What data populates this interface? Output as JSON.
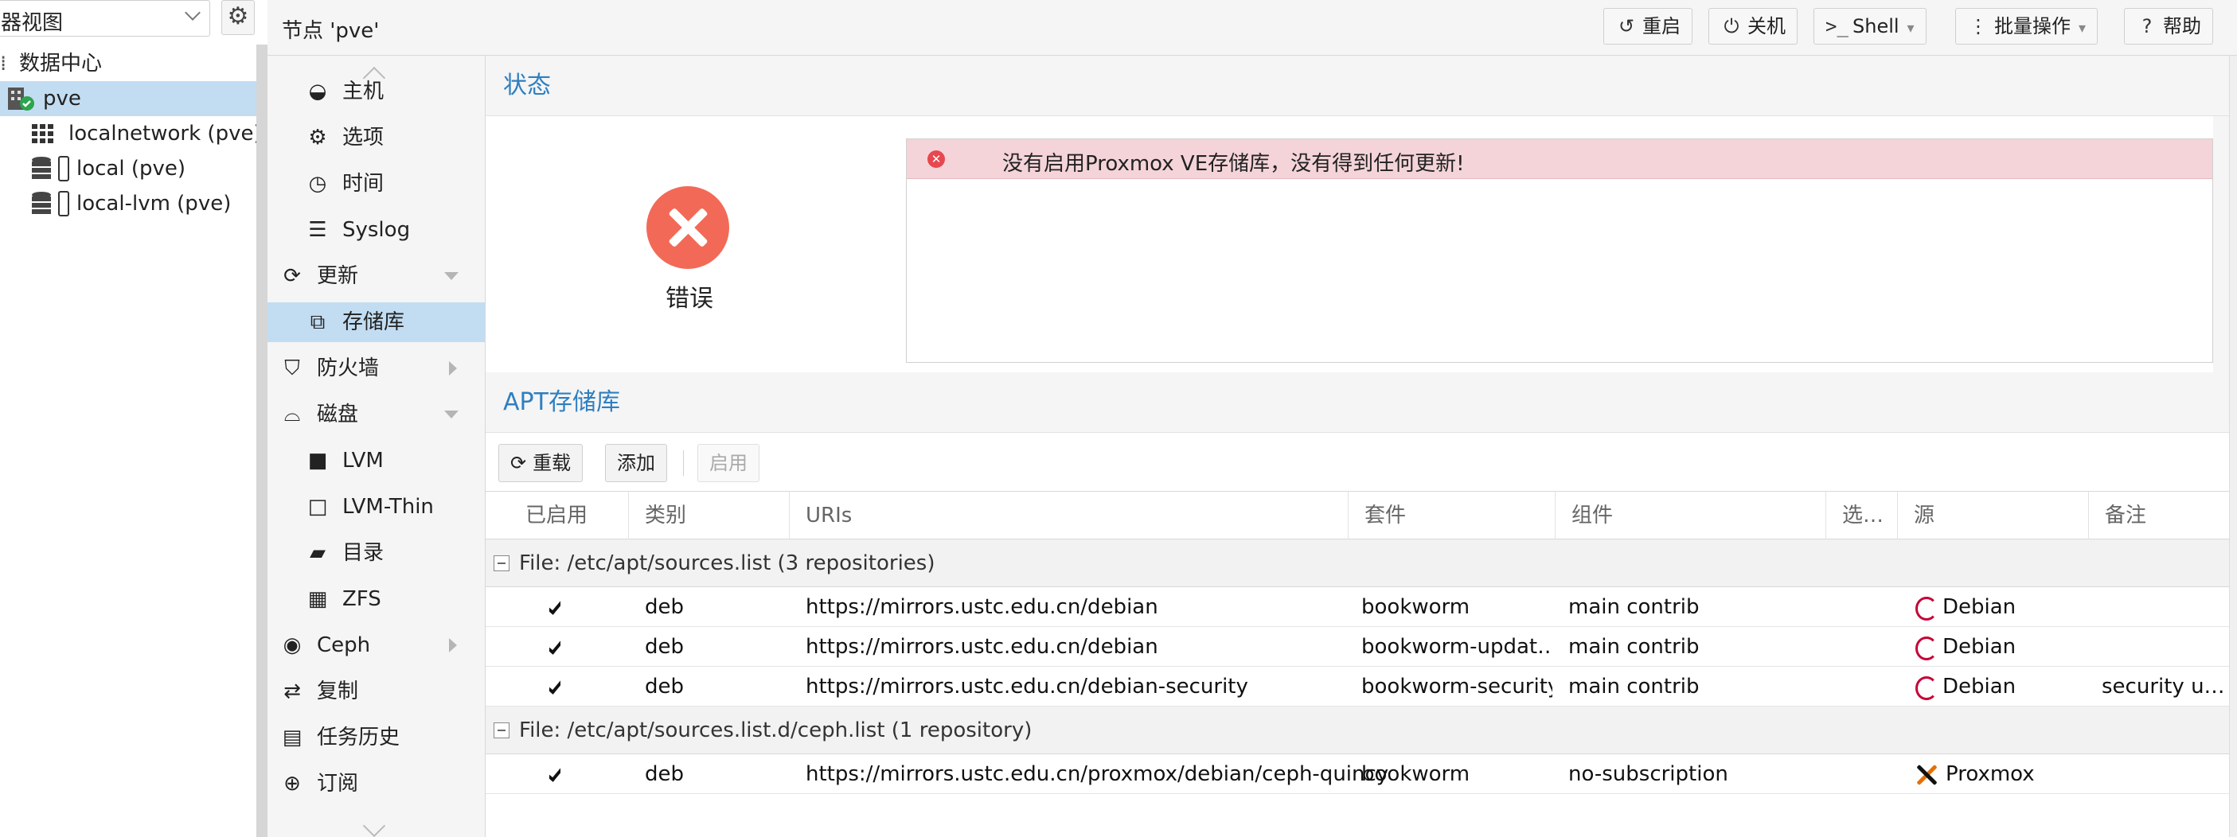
{
  "tree": {
    "view_select": "器视图",
    "items": [
      {
        "label": "数据中心"
      },
      {
        "label": "pve"
      },
      {
        "label": "localnetwork (pve)"
      },
      {
        "label": "local (pve)"
      },
      {
        "label": "local-lvm (pve)"
      }
    ]
  },
  "header": {
    "title": "节点 'pve'",
    "buttons": {
      "reboot": "重启",
      "shutdown": "关机",
      "shell": "Shell",
      "bulk": "批量操作",
      "help": "帮助"
    }
  },
  "menu": {
    "items": [
      {
        "label": "主机",
        "icon": "host-icon"
      },
      {
        "label": "选项",
        "icon": "gear-icon"
      },
      {
        "label": "时间",
        "icon": "clock-icon"
      },
      {
        "label": "Syslog",
        "icon": "list-icon"
      },
      {
        "label": "更新",
        "icon": "refresh-icon"
      },
      {
        "label": "存储库",
        "icon": "copy-icon"
      },
      {
        "label": "防火墙",
        "icon": "shield-icon"
      },
      {
        "label": "磁盘",
        "icon": "hdd-icon"
      },
      {
        "label": "LVM",
        "icon": "square-icon"
      },
      {
        "label": "LVM-Thin",
        "icon": "square-outline-icon"
      },
      {
        "label": "目录",
        "icon": "folder-icon"
      },
      {
        "label": "ZFS",
        "icon": "grid-icon"
      },
      {
        "label": "Ceph",
        "icon": "ceph-icon"
      },
      {
        "label": "复制",
        "icon": "retweet-icon"
      },
      {
        "label": "任务历史",
        "icon": "tasks-icon"
      },
      {
        "label": "订阅",
        "icon": "lifebuoy-icon"
      }
    ]
  },
  "status": {
    "title": "状态",
    "state_label": "错误",
    "message": "没有启用Proxmox VE存储库，没有得到任何更新!"
  },
  "apt": {
    "title": "APT存储库",
    "buttons": {
      "reload": "重载",
      "add": "添加",
      "enable": "启用"
    },
    "columns": [
      "已启用",
      "类别",
      "URIs",
      "套件",
      "组件",
      "选…",
      "源",
      "备注"
    ],
    "groups": [
      {
        "label": "File: /etc/apt/sources.list (3 repositories)",
        "rows": [
          {
            "enabled": "✔",
            "type": "deb",
            "uri": "https://mirrors.ustc.edu.cn/debian",
            "suite": "bookworm",
            "components": "main contrib",
            "options": "",
            "origin": "Debian",
            "comment": ""
          },
          {
            "enabled": "✔",
            "type": "deb",
            "uri": "https://mirrors.ustc.edu.cn/debian",
            "suite": "bookworm-updat…",
            "components": "main contrib",
            "options": "",
            "origin": "Debian",
            "comment": ""
          },
          {
            "enabled": "✔",
            "type": "deb",
            "uri": "https://mirrors.ustc.edu.cn/debian-security",
            "suite": "bookworm-security",
            "components": "main contrib",
            "options": "",
            "origin": "Debian",
            "comment": "security u…"
          }
        ]
      },
      {
        "label": "File: /etc/apt/sources.list.d/ceph.list (1 repository)",
        "rows": [
          {
            "enabled": "✔",
            "type": "deb",
            "uri": "https://mirrors.ustc.edu.cn/proxmox/debian/ceph-quincy",
            "suite": "bookworm",
            "components": "no-subscription",
            "options": "",
            "origin": "Proxmox",
            "comment": ""
          }
        ]
      }
    ]
  }
}
